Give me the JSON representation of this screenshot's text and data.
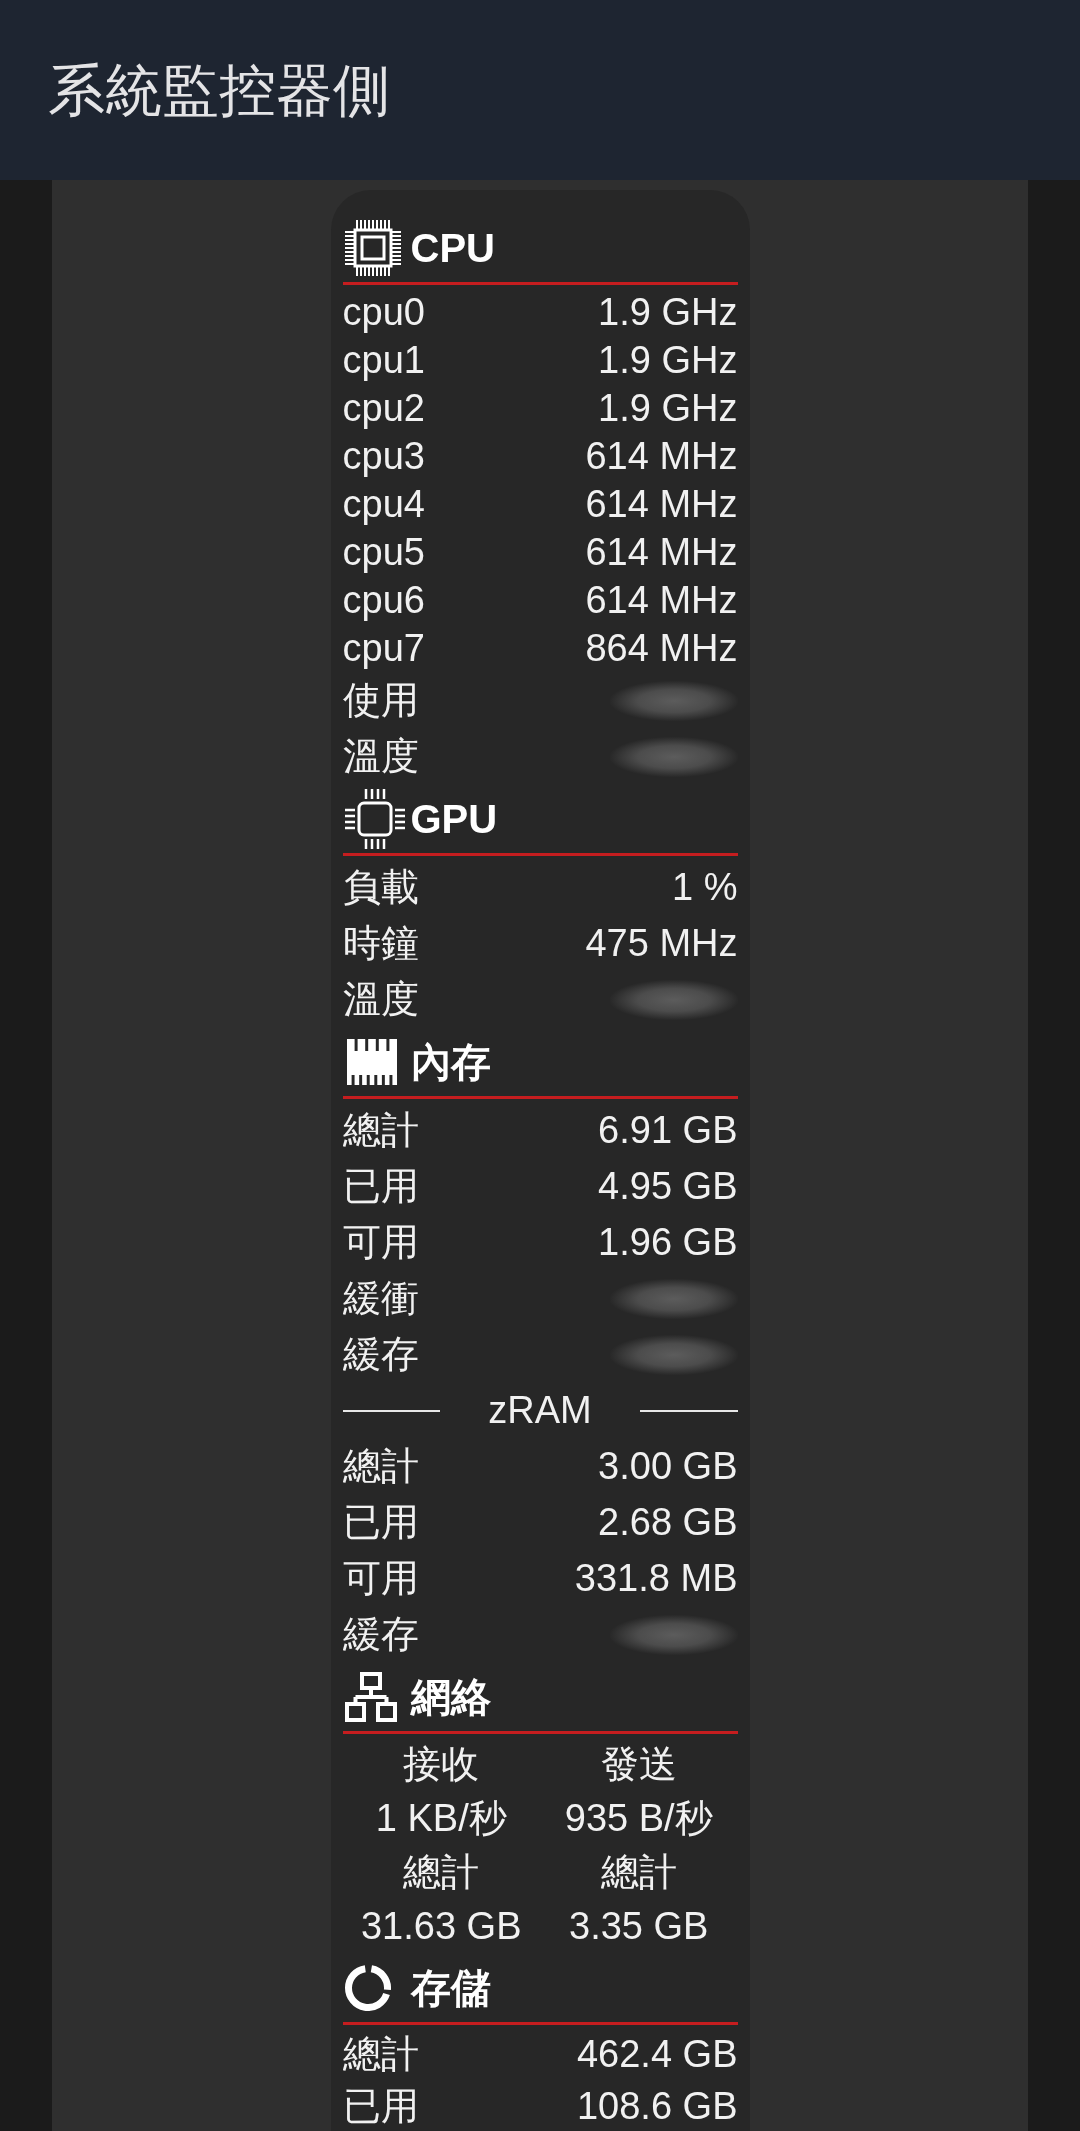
{
  "app_bar": {
    "title": "系統監控器側"
  },
  "sections": [
    {
      "kind": "cpu",
      "title": "CPU",
      "cores": [
        {
          "label": "cpu0",
          "value": "1.9 GHz"
        },
        {
          "label": "cpu1",
          "value": "1.9 GHz"
        },
        {
          "label": "cpu2",
          "value": "1.9 GHz"
        },
        {
          "label": "cpu3",
          "value": "614 MHz"
        },
        {
          "label": "cpu4",
          "value": "614 MHz"
        },
        {
          "label": "cpu5",
          "value": "614 MHz"
        },
        {
          "label": "cpu6",
          "value": "614 MHz"
        },
        {
          "label": "cpu7",
          "value": "864 MHz"
        }
      ],
      "rows": [
        {
          "kind": "blurred",
          "label": "使用"
        },
        {
          "kind": "blurred",
          "label": "溫度"
        }
      ]
    },
    {
      "kind": "gpu",
      "title": "GPU",
      "rows": [
        {
          "kind": "value",
          "label": "負載",
          "value": "1 %"
        },
        {
          "kind": "value",
          "label": "時鐘",
          "value": "475 MHz"
        },
        {
          "kind": "blurred",
          "label": "溫度"
        }
      ]
    },
    {
      "kind": "memory",
      "title": "內存",
      "rows": [
        {
          "kind": "value",
          "label": "總計",
          "value": "6.91 GB"
        },
        {
          "kind": "value",
          "label": "已用",
          "value": "4.95 GB"
        },
        {
          "kind": "value",
          "label": "可用",
          "value": "1.96 GB"
        },
        {
          "kind": "blurred",
          "label": "緩衝"
        },
        {
          "kind": "blurred",
          "label": "緩存"
        }
      ],
      "zram": {
        "title": "zRAM",
        "rows": [
          {
            "kind": "value",
            "label": "總計",
            "value": "3.00 GB"
          },
          {
            "kind": "value",
            "label": "已用",
            "value": "2.68 GB"
          },
          {
            "kind": "value",
            "label": "可用",
            "value": "331.8 MB"
          },
          {
            "kind": "blurred",
            "label": "緩存"
          }
        ]
      }
    },
    {
      "kind": "network",
      "title": "網絡",
      "columns": [
        {
          "heading": "接收",
          "rate": "1 KB/秒",
          "total_label": "總計",
          "total": "31.63 GB"
        },
        {
          "heading": "發送",
          "rate": "935 B/秒",
          "total_label": "總計",
          "total": "3.35 GB"
        }
      ]
    },
    {
      "kind": "storage",
      "title": "存儲",
      "rows": [
        {
          "kind": "value",
          "label": "總計",
          "value": "462.4 GB"
        },
        {
          "kind": "value",
          "label": "已用",
          "value": "108.6 GB"
        }
      ]
    }
  ]
}
